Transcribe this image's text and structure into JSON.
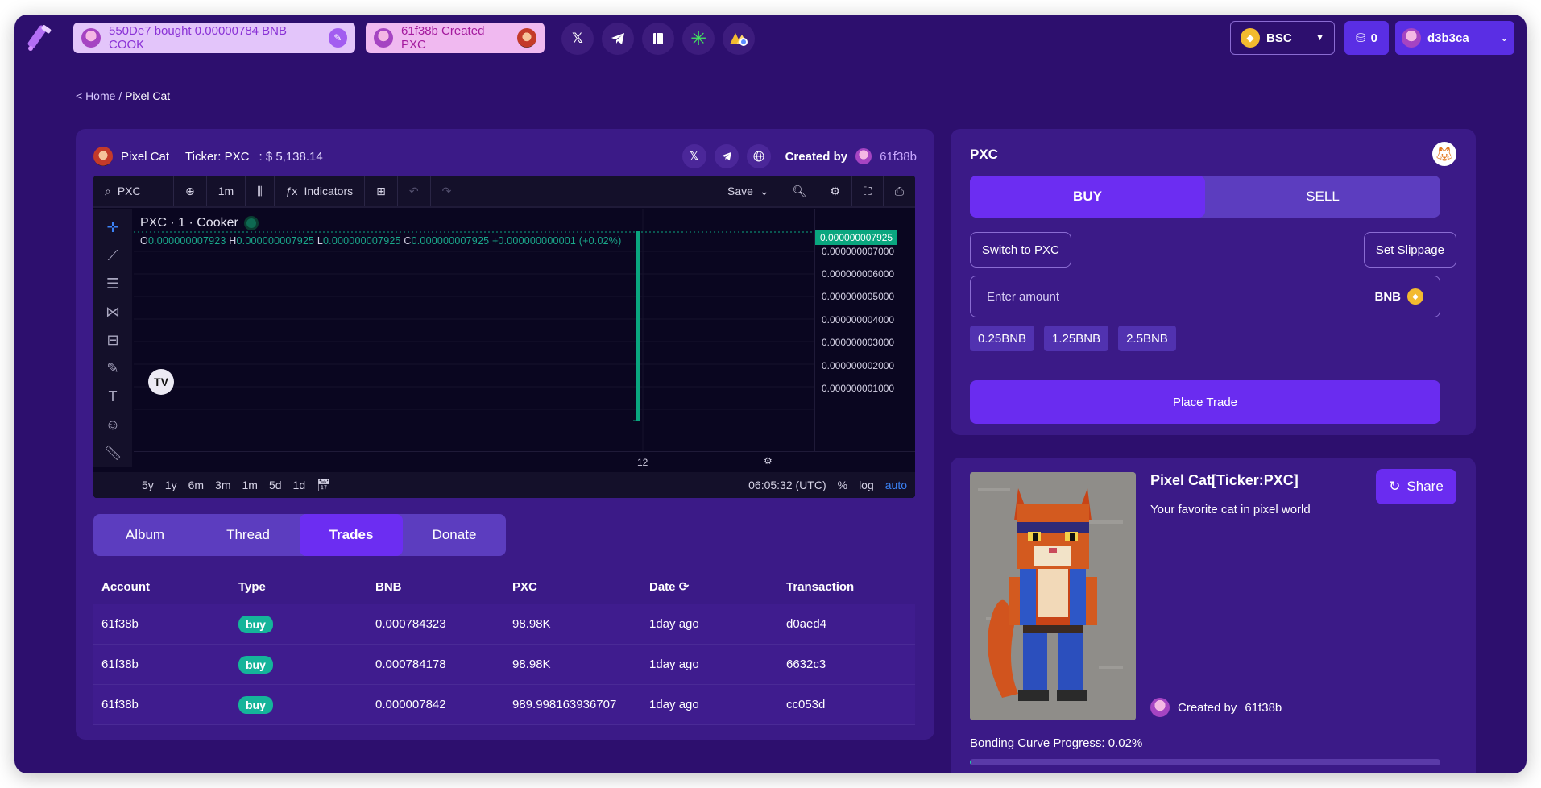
{
  "topbar": {
    "ticker_feed": [
      {
        "text": "550De7 bought 0.00000784 BNB COOK"
      },
      {
        "text": "61f38b Created PXC"
      }
    ],
    "socials": [
      "x-icon",
      "telegram-icon",
      "docs-icon",
      "linktree-icon",
      "gitbook-icon"
    ],
    "chain": "BSC",
    "coin_count": "0",
    "username": "d3b3ca"
  },
  "breadcrumb": {
    "home": "< Home",
    "separator": "/",
    "current": "Pixel Cat"
  },
  "token": {
    "name": "Pixel Cat",
    "ticker_label": "Ticker: PXC",
    "market_cap": ": $ 5,138.14",
    "created_by_label": "Created by",
    "creator": "61f38b"
  },
  "chart": {
    "symbol": "PXC",
    "interval": "1m",
    "indicators_label": "Indicators",
    "save_label": "Save",
    "title": "PXC · 1 · Cooker",
    "ohlc": {
      "o_label": "O",
      "o": "0.000000007923",
      "h_label": "H",
      "h": "0.000000007925",
      "l_label": "L",
      "l": "0.000000007925",
      "c_label": "C",
      "c": "0.000000007925",
      "change": "+0.000000000001 (+0.02%)"
    },
    "last_price": "0.000000007925",
    "y_ticks": [
      "0.000000007000",
      "0.000000006000",
      "0.000000005000",
      "0.000000004000",
      "0.000000003000",
      "0.000000002000",
      "0.000000001000"
    ],
    "x_label": "12",
    "ranges": [
      "5y",
      "1y",
      "6m",
      "3m",
      "1m",
      "5d",
      "1d"
    ],
    "time": "06:05:32 (UTC)",
    "percent_label": "%",
    "log_label": "log",
    "auto_label": "auto",
    "tv_logo": "TV"
  },
  "tabs": [
    {
      "label": "Album",
      "active": false
    },
    {
      "label": "Thread",
      "active": false
    },
    {
      "label": "Trades",
      "active": true
    },
    {
      "label": "Donate",
      "active": false
    }
  ],
  "trades": {
    "headers": [
      "Account",
      "Type",
      "BNB",
      "PXC",
      "Date",
      "Transaction"
    ],
    "rows": [
      {
        "account": "61f38b",
        "type": "buy",
        "bnb": "0.000784323",
        "pxc": "98.98K",
        "date": "1day ago",
        "tx": "d0aed4"
      },
      {
        "account": "61f38b",
        "type": "buy",
        "bnb": "0.000784178",
        "pxc": "98.98K",
        "date": "1day ago",
        "tx": "6632c3"
      },
      {
        "account": "61f38b",
        "type": "buy",
        "bnb": "0.000007842",
        "pxc": "989.998163936707",
        "date": "1day ago",
        "tx": "cc053d"
      }
    ]
  },
  "trade_panel": {
    "title": "PXC",
    "buy_label": "BUY",
    "sell_label": "SELL",
    "switch_label": "Switch to PXC",
    "slippage_label": "Set Slippage",
    "amount_placeholder": "Enter amount",
    "amount_unit": "BNB",
    "quick_amounts": [
      "0.25BNB",
      "1.25BNB",
      "2.5BNB"
    ],
    "place_trade_label": "Place Trade"
  },
  "info_panel": {
    "name": "Pixel Cat[Ticker:PXC]",
    "description": "Your favorite cat in pixel world",
    "share_label": "Share",
    "created_by_label": "Created by",
    "creator": "61f38b",
    "bonding_label": "Bonding Curve Progress: 0.02%",
    "bonding_progress": 0.0002
  },
  "colors": {
    "background": "#2d0f6e",
    "panel": "#3b1a87",
    "accent": "#6c2df2",
    "buy_badge": "#15b49a",
    "candle": "#0aa67f"
  }
}
